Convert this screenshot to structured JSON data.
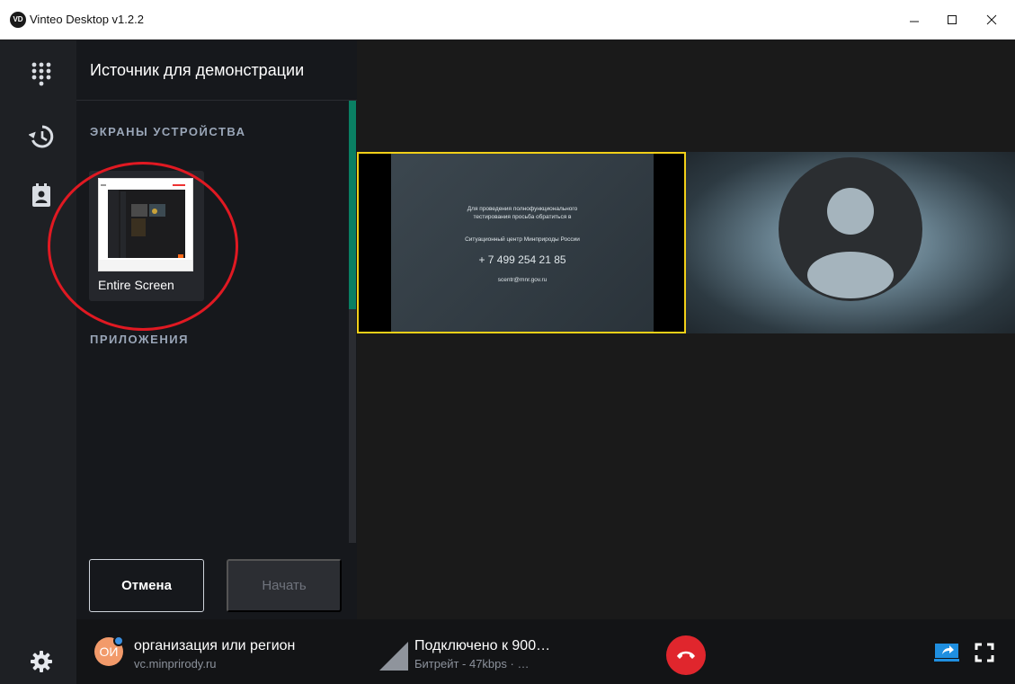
{
  "window": {
    "logo": "VD",
    "title": "Vinteo Desktop v1.2.2"
  },
  "panel": {
    "title": "Источник для демонстрации",
    "section_screens": "ЭКРАНЫ УСТРОЙСТВА",
    "section_apps": "ПРИЛОЖЕНИЯ",
    "screen_option": "Entire Screen",
    "cancel_label": "Отмена",
    "start_label": "Начать"
  },
  "shared_slide": {
    "line1": "Для проведения полнофункционального",
    "line2": "тестирования просьба обратиться в",
    "line3": "Ситуационный центр Минприроды России",
    "phone": "+ 7 499 254 21 85",
    "email": "scentr@mnr.gov.ru"
  },
  "bottom": {
    "user_initials": "ОИ",
    "user_name": "организация или регион",
    "user_domain": "vc.minprirody.ru",
    "conn_status": "Подключено к 900…",
    "conn_bitrate": "Битрейт - 47kbps  ·  …"
  },
  "icons": {
    "rail": [
      "dialpad-icon",
      "history-icon",
      "contacts-icon"
    ],
    "settings": "gear-icon",
    "hangup": "phone-hangup-icon",
    "share": "screen-share-icon",
    "fullscreen": "fullscreen-icon"
  },
  "colors": {
    "accent_green": "#0a7f63",
    "highlight_yellow": "#f2d018",
    "hangup_red": "#e0262d",
    "share_blue": "#1f8fe0"
  }
}
